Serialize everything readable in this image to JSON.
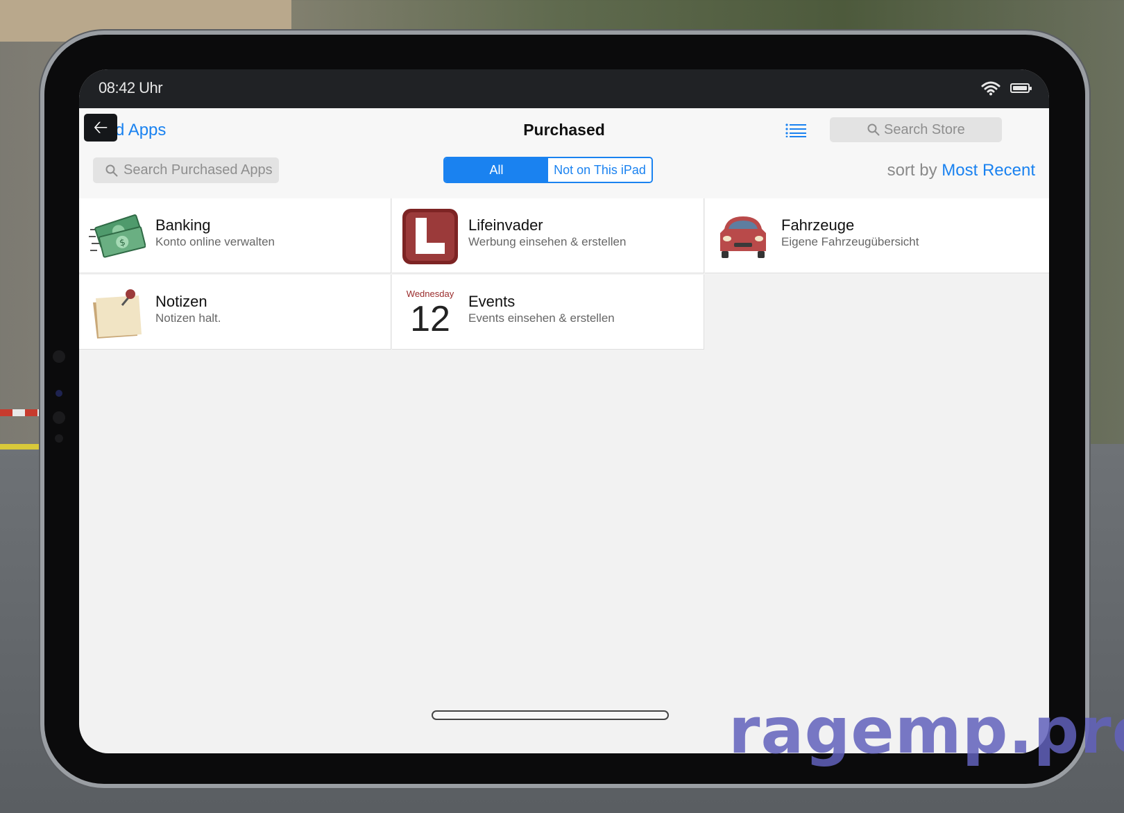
{
  "status_bar": {
    "time": "08:42 Uhr"
  },
  "nav": {
    "back_label": "d Apps",
    "title": "Purchased",
    "store_search_placeholder": "Search Store",
    "purchased_search_placeholder": "Search Purchased Apps",
    "segments": [
      "All",
      "Not on This iPad"
    ],
    "selected_segment": "All",
    "sort_prefix": "sort by",
    "sort_value": "Most Recent"
  },
  "apps": [
    {
      "name": "Banking",
      "description": "Konto online verwalten",
      "icon": "money-icon"
    },
    {
      "name": "Lifeinvader",
      "description": "Werbung einsehen & erstellen",
      "icon": "lifeinvader-icon"
    },
    {
      "name": "Fahrzeuge",
      "description": "Eigene Fahrzeugübersicht",
      "icon": "car-icon"
    },
    {
      "name": "Notizen",
      "description": "Notizen halt.",
      "icon": "notes-icon"
    },
    {
      "name": "Events",
      "description": "Events einsehen & erstellen",
      "icon": "calendar-icon",
      "calendar_day": "Wednesday",
      "calendar_date": "12"
    }
  ],
  "watermark": "ragemp.pro",
  "colors": {
    "accent": "#1a82f0",
    "status_bar": "#202225",
    "screen_bg": "#f2f2f2",
    "lifeinvader": "#8b2a2a"
  }
}
